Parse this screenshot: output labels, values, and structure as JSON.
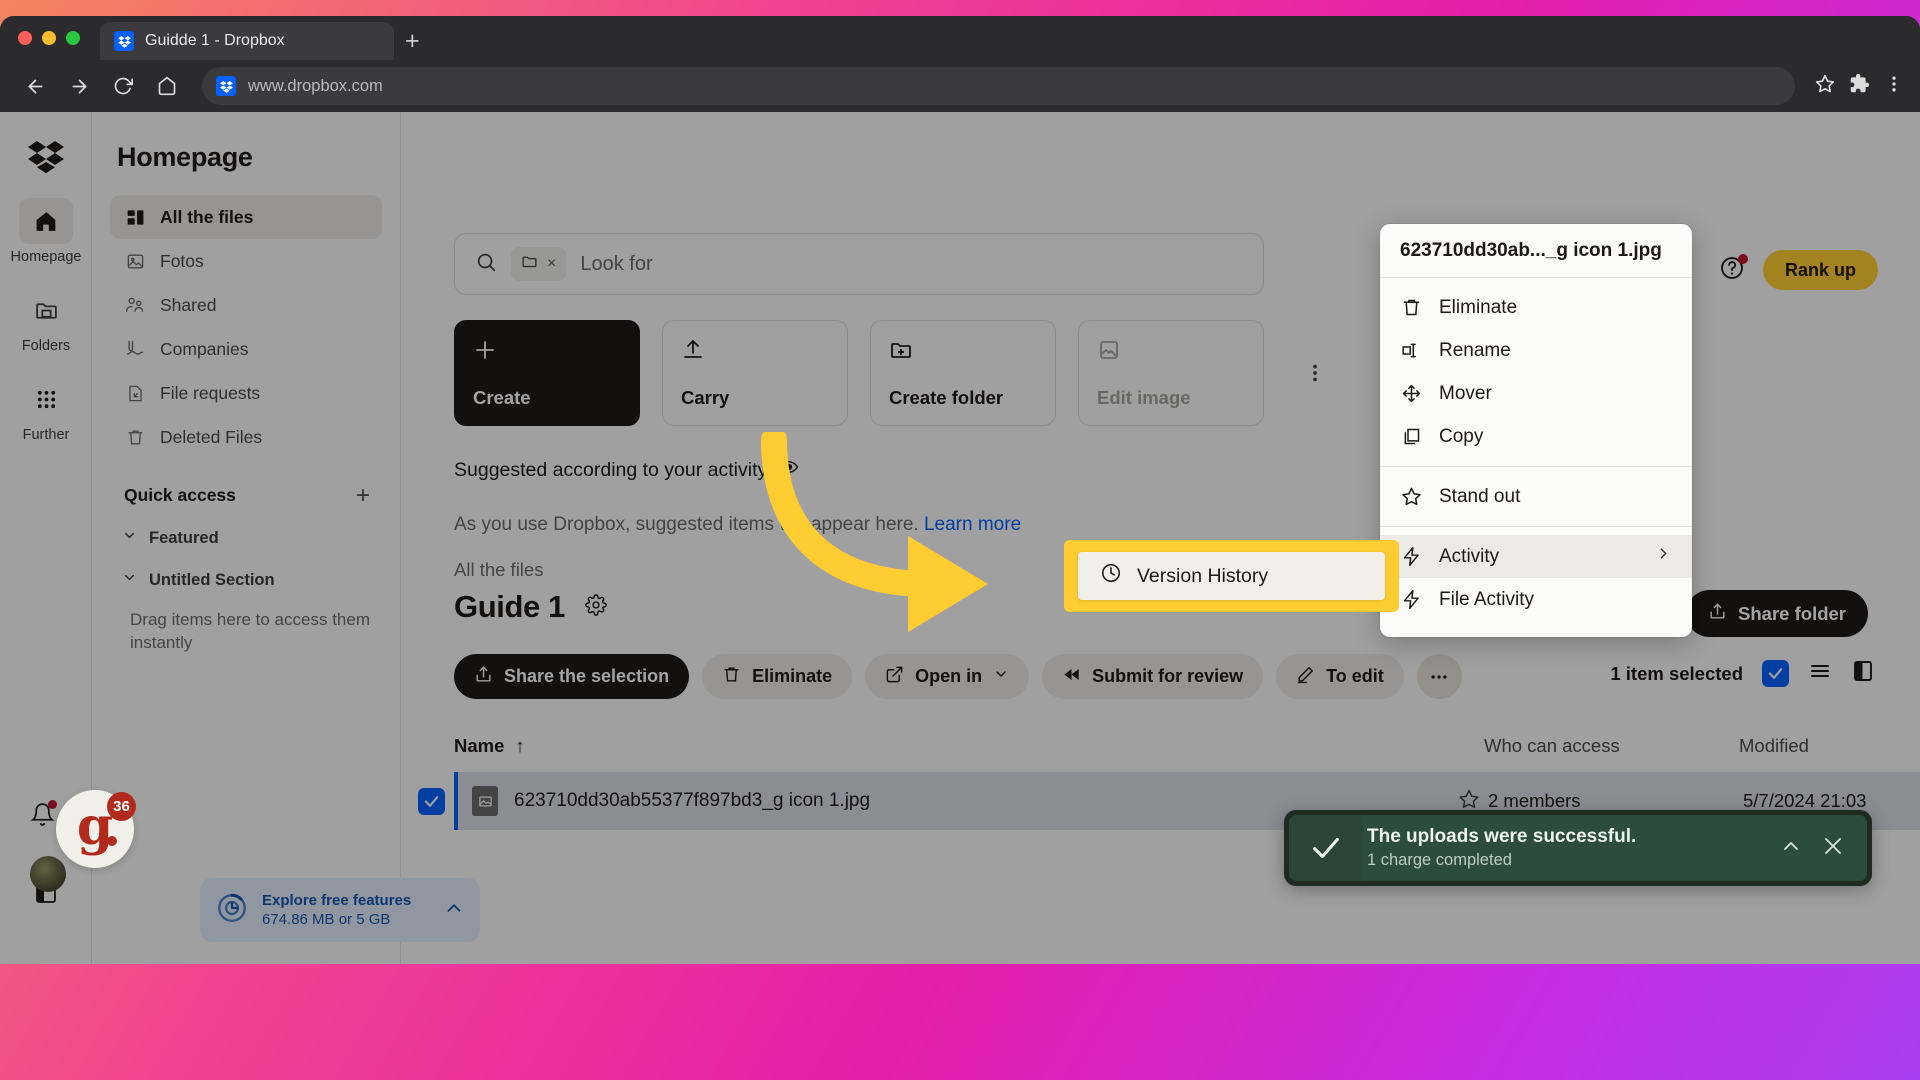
{
  "browser": {
    "tab_title": "Guidde 1 - Dropbox",
    "new_tab_label": "+",
    "url": "www.dropbox.com"
  },
  "rail": {
    "items": [
      {
        "label": "Homepage",
        "icon": "home-icon"
      },
      {
        "label": "Folders",
        "icon": "folder-icon"
      },
      {
        "label": "Further",
        "icon": "grid-dots-icon"
      }
    ]
  },
  "sidebar": {
    "title": "Homepage",
    "items": [
      {
        "label": "All the files",
        "icon": "all-files-icon"
      },
      {
        "label": "Fotos",
        "icon": "photo-icon"
      },
      {
        "label": "Shared",
        "icon": "people-icon"
      },
      {
        "label": "Companies",
        "icon": "signature-icon"
      },
      {
        "label": "File requests",
        "icon": "file-request-icon"
      },
      {
        "label": "Deleted Files",
        "icon": "trash-icon"
      }
    ],
    "quick_access": {
      "title": "Quick access",
      "add_label": "+",
      "sections": [
        {
          "label": "Featured"
        },
        {
          "label": "Untitled Section"
        }
      ],
      "hint": "Drag items here to access them instantly"
    },
    "storage": {
      "title": "Explore free features",
      "detail": "674.86 MB or 5 GB"
    },
    "guidde_badge_count": "36"
  },
  "header": {
    "help_icon": "help-circle-icon",
    "rank_up_label": "Rank up",
    "rank_up_color": "#ffcd31"
  },
  "search": {
    "placeholder": "Look for",
    "chip_icon": "folder-icon",
    "chip_close": "×",
    "search_icon": "search-icon"
  },
  "action_cards": [
    {
      "label": "Create",
      "icon": "plus-icon",
      "style": "dark"
    },
    {
      "label": "Carry",
      "icon": "upload-icon",
      "style": "outline"
    },
    {
      "label": "Create folder",
      "icon": "folder-plus-icon",
      "style": "outline"
    },
    {
      "label": "Edit image",
      "icon": "edit-image-icon",
      "style": "disabled"
    }
  ],
  "suggested": {
    "title": "Suggested according to your activity",
    "eye_icon": "eye-icon",
    "body_before": "As you use Dropbox, suggested items will appear here. ",
    "body_link": "Learn more"
  },
  "breadcrumb": "All the files",
  "folder": {
    "name": "Guide 1",
    "gear_icon": "gear-icon",
    "share_label": "Share folder"
  },
  "toolbar": {
    "buttons": [
      {
        "label": "Share the selection",
        "icon": "share-icon",
        "style": "primary"
      },
      {
        "label": "Eliminate",
        "icon": "trash-icon",
        "style": "default"
      },
      {
        "label": "Open in",
        "icon": "open-external-icon",
        "style": "default",
        "caret": true
      },
      {
        "label": "Submit for review",
        "icon": "rewind-icon",
        "style": "default"
      },
      {
        "label": "To edit",
        "icon": "pencil-icon",
        "style": "default"
      }
    ],
    "overflow_label": "•••",
    "selection_text": "1 item selected",
    "list_view_icon": "list-view-icon",
    "panel_icon": "side-panel-icon"
  },
  "table": {
    "headers": {
      "name": "Name",
      "sort_arrow": "↑",
      "access": "Who can access",
      "modified": "Modified"
    },
    "rows": [
      {
        "name": "623710dd30ab55377f897bd3_g icon 1.jpg",
        "access": "2 members",
        "modified": "5/7/2024 21:03",
        "selected": true
      }
    ]
  },
  "context_menu": {
    "title": "623710dd30ab..._g icon 1.jpg",
    "groups": [
      {
        "items": [
          {
            "label": "Eliminate",
            "icon": "trash-icon"
          },
          {
            "label": "Rename",
            "icon": "rename-icon"
          },
          {
            "label": "Mover",
            "icon": "move-icon"
          },
          {
            "label": "Copy",
            "icon": "copy-icon"
          }
        ]
      },
      {
        "items": [
          {
            "label": "Stand out",
            "icon": "star-icon"
          }
        ]
      },
      {
        "items": [
          {
            "label": "Activity",
            "icon": "bolt-icon",
            "submenu": true,
            "highlighted": true
          },
          {
            "label": "File Activity",
            "icon": "bolt-icon"
          }
        ]
      }
    ]
  },
  "submenu": {
    "label": "Version History",
    "icon": "clock-icon",
    "highlight_color": "#ffcd31"
  },
  "toast": {
    "title": "The uploads were successful.",
    "subtitle": "1 charge completed",
    "check_icon": "check-icon",
    "collapse_icon": "chevron-up-icon",
    "close_icon": "close-icon",
    "color": "#2c4d3d"
  }
}
